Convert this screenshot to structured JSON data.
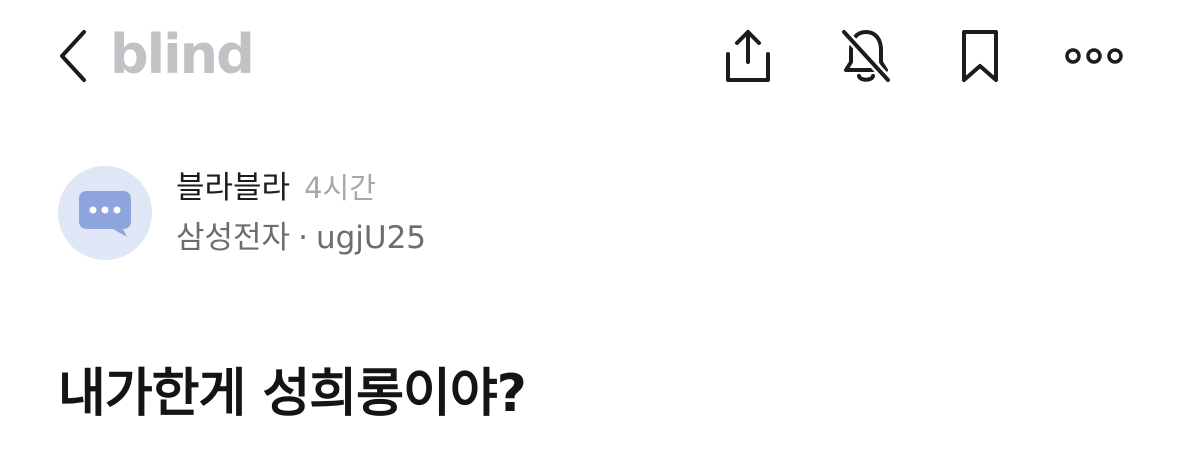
{
  "header": {
    "brand": "blind",
    "icons": {
      "back": "chevron-left-icon",
      "share": "share-icon",
      "mute": "bell-off-icon",
      "bookmark": "bookmark-icon",
      "more": "more-horizontal-icon"
    }
  },
  "author": {
    "channel": "블라블라",
    "time": "4시간",
    "company": "삼성전자",
    "separator": "·",
    "nickname": "ugjU25",
    "avatar_icon": "chat-bubble-icon"
  },
  "post": {
    "title": "내가한게 성희롱이야?"
  },
  "colors": {
    "brand_gray": "#c2c2c6",
    "avatar_bg": "#dfe6f6",
    "avatar_bubble": "#8ea4dc",
    "text_primary": "#1c1c1e",
    "text_secondary": "#6c6c72",
    "text_muted": "#a7a7ad"
  }
}
